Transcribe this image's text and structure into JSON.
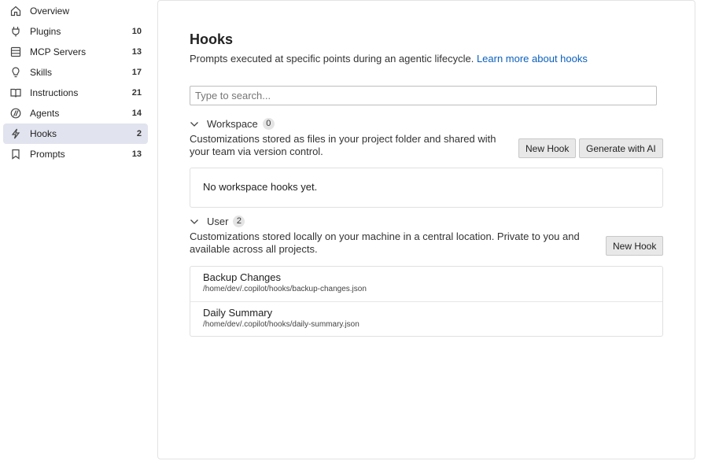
{
  "sidebar": {
    "items": [
      {
        "label": "Overview",
        "count": "",
        "icon": "home-icon"
      },
      {
        "label": "Plugins",
        "count": "10",
        "icon": "plug-icon"
      },
      {
        "label": "MCP Servers",
        "count": "13",
        "icon": "server-icon"
      },
      {
        "label": "Skills",
        "count": "17",
        "icon": "lightbulb-icon"
      },
      {
        "label": "Instructions",
        "count": "21",
        "icon": "book-icon"
      },
      {
        "label": "Agents",
        "count": "14",
        "icon": "agent-icon"
      },
      {
        "label": "Hooks",
        "count": "2",
        "icon": "lightning-icon"
      },
      {
        "label": "Prompts",
        "count": "13",
        "icon": "bookmark-icon"
      }
    ],
    "active_index": 6
  },
  "main": {
    "title": "Hooks",
    "description": "Prompts executed at specific points during an agentic lifecycle.",
    "learn_more": "Learn more about hooks",
    "search_placeholder": "Type to search...",
    "workspace": {
      "title": "Workspace",
      "count": "0",
      "description_line1": "Customizations stored as files in your project folder and shared with",
      "description_line2": "your team via version control.",
      "new_hook_label": "New Hook",
      "generate_label": "Generate with AI",
      "empty_text": "No workspace hooks yet."
    },
    "user": {
      "title": "User",
      "count": "2",
      "description_line1": "Customizations stored locally on your machine in a central location. Private to you and",
      "description_line2": "available across all projects.",
      "new_hook_label": "New Hook",
      "hooks": [
        {
          "name": "Backup Changes",
          "path": "/home/dev/.copilot/hooks/backup-changes.json"
        },
        {
          "name": "Daily Summary",
          "path": "/home/dev/.copilot/hooks/daily-summary.json"
        }
      ]
    }
  },
  "colors": {
    "accent_link": "#0b60bd",
    "active_nav_bg": "#e1e3ee",
    "button_bg": "#e8e8e8"
  }
}
